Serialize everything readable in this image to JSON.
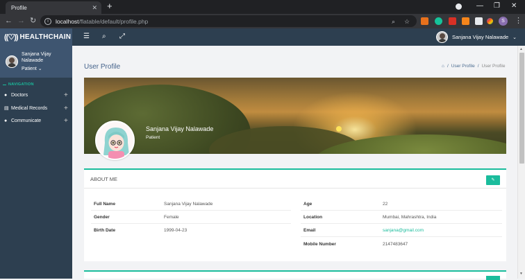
{
  "browser": {
    "tab_title": "Profile",
    "tab_close": "✕",
    "new_tab": "+",
    "url_host": "localhost",
    "url_path": "/flatable/default/profile.php",
    "profile_initial": "S",
    "window_controls": {
      "minimize": "—",
      "restore": "❐",
      "close": "✕"
    }
  },
  "app": {
    "brand": "HEALTHCHAIN",
    "brand_mark": "((♡))",
    "header_user_name": "Sanjana Vijay Nalawade",
    "header_caret": "⌄",
    "icons": {
      "menu": "☰",
      "search": "⌕",
      "fullscreen": "⤢"
    }
  },
  "sidebar": {
    "user_name": "Sanjana Vijay Nalawade",
    "user_role": "Patient ⌄",
    "nav_heading": "NAVIGATION",
    "items": [
      {
        "label": "Doctors",
        "icon": "doctors-icon"
      },
      {
        "label": "Medical Records",
        "icon": "records-icon"
      },
      {
        "label": "Communicate",
        "icon": "chat-icon"
      }
    ]
  },
  "page": {
    "title": "User Profile",
    "breadcrumb": [
      "User Profile",
      "User Profile"
    ],
    "breadcrumb_sep": "/"
  },
  "profile": {
    "name": "Sanjana Vijay Nalawade",
    "role": "Patient"
  },
  "about": {
    "title": "ABOUT ME",
    "edit_icon": "✎",
    "left": [
      {
        "label": "Full Name",
        "value": "Sanjana Vijay Nalawade"
      },
      {
        "label": "Gender",
        "value": "Female"
      },
      {
        "label": "Birth Date",
        "value": "1999-04-23"
      }
    ],
    "right": [
      {
        "label": "Age",
        "value": "22"
      },
      {
        "label": "Location",
        "value": "Mumbai, Mahrashtra, India"
      },
      {
        "label": "Email",
        "value": "sanjana@gmail.com"
      },
      {
        "label": "Mobile Number",
        "value": "2147483647"
      }
    ]
  },
  "colors": {
    "accent": "#1abc9c",
    "sidebar": "#2d3f50",
    "logo_bg": "#3e5570"
  }
}
